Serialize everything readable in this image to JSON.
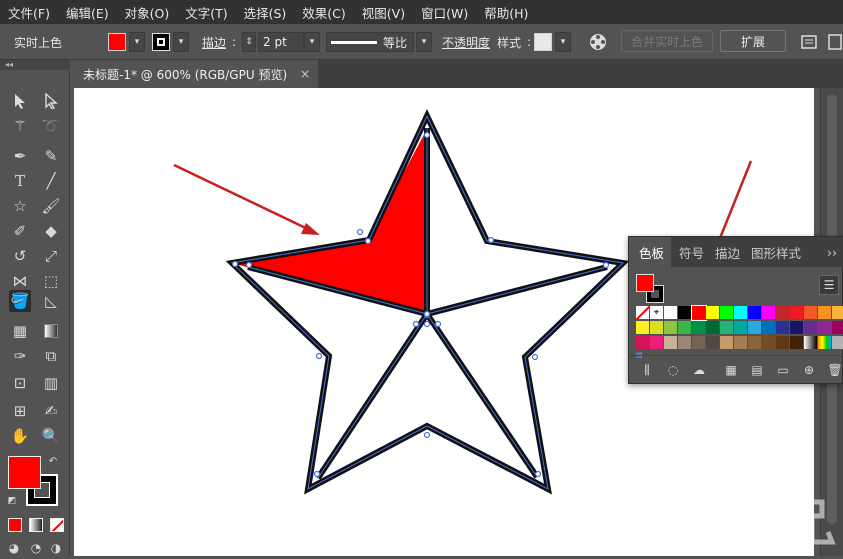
{
  "menu": [
    "文件(F)",
    "编辑(E)",
    "对象(O)",
    "文字(T)",
    "选择(S)",
    "效果(C)",
    "视图(V)",
    "窗口(W)",
    "帮助(H)"
  ],
  "options": {
    "live_paint_label": "实时上色",
    "fill_color": "#ff0000",
    "stroke_label": "描边",
    "stroke_weight": "2 pt",
    "profile_label": "等比",
    "opacity_label": "不透明度",
    "style_label": "样式",
    "merge_button": "合并实时上色",
    "expand_button": "扩展"
  },
  "document": {
    "tab_title": "未标题-1* @ 600% (RGB/GPU 预览)",
    "close_glyph": "×"
  },
  "toolbar": {
    "fill_color": "#ff0000",
    "stroke_color": "#000000"
  },
  "swatches_panel": {
    "tabs": [
      "色板",
      "符号",
      "描边",
      "图形样式"
    ],
    "more_glyph": "››",
    "fill": "#ff0000",
    "stroke": "#000000",
    "rows": [
      [
        "none",
        "reg",
        "#ffffff",
        "#000000",
        "#ff0000",
        "#ffff00",
        "#00ff00",
        "#00ffff",
        "#0000ff",
        "#ff00ff",
        "#c1272d",
        "#ed1c24",
        "#f15a24",
        "#f7931e",
        "#fbb03b"
      ],
      [
        "#fcee21",
        "#d9e021",
        "#8cc63f",
        "#39b54a",
        "#009245",
        "#006837",
        "#22b573",
        "#00a99d",
        "#29abe2",
        "#0071bc",
        "#2e3192",
        "#1b1464",
        "#662d91",
        "#93278f",
        "#9e005d"
      ],
      [
        "#d4145a",
        "#ed1e79",
        "#c7b299",
        "#998675",
        "#736357",
        "#534741",
        "#c69c6d",
        "#a67c52",
        "#8c6239",
        "#754c24",
        "#603813",
        "#42210b",
        "gradient-grey",
        "gradient-rainbow",
        "#b3b3b3"
      ]
    ]
  },
  "watermark": "下载吧"
}
